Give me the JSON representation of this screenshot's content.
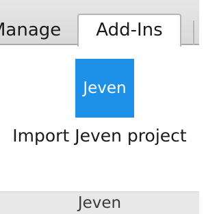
{
  "tabs": {
    "manage_label": "Manage",
    "addins_label": "Add-Ins"
  },
  "ribbon": {
    "button": {
      "icon_text": "Jeven",
      "label": "Import Jeven project",
      "icon_color": "#1e90e8"
    },
    "group_label": "Jeven"
  }
}
